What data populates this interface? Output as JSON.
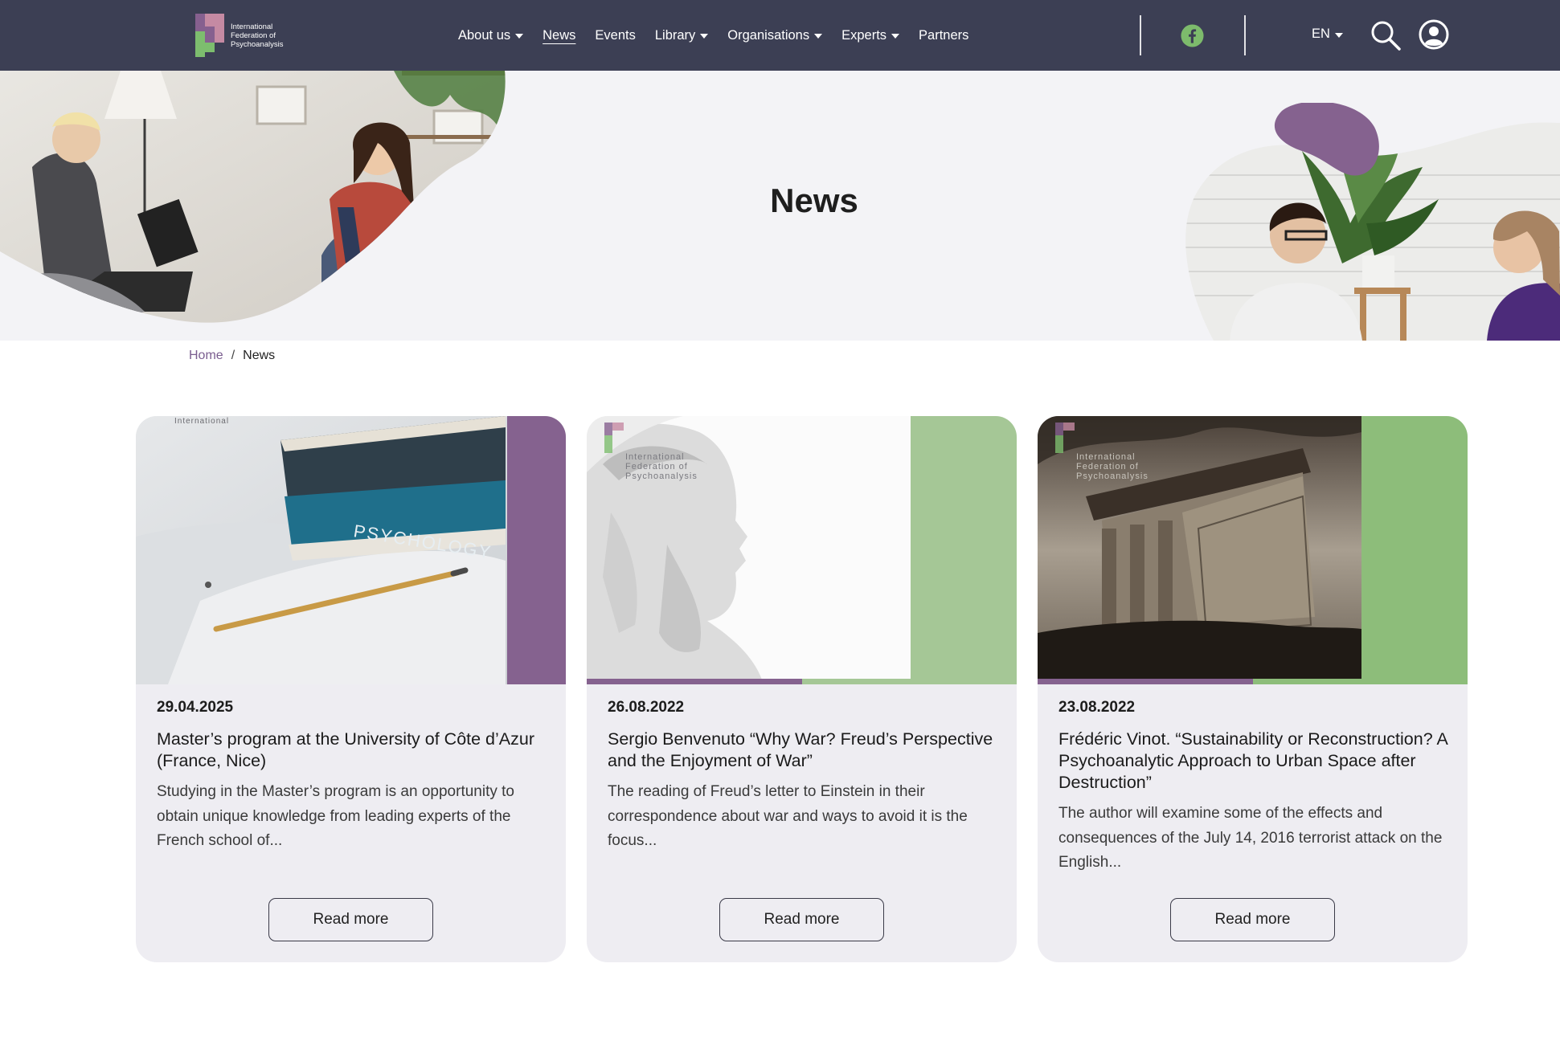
{
  "logo": {
    "lines": [
      "International",
      "Federation of",
      "Psychoanalysis"
    ]
  },
  "nav": {
    "items": [
      {
        "label": "About us",
        "dropdown": true
      },
      {
        "label": "News",
        "dropdown": false,
        "active": true
      },
      {
        "label": "Events",
        "dropdown": false
      },
      {
        "label": "Library",
        "dropdown": true
      },
      {
        "label": "Organisations",
        "dropdown": true
      },
      {
        "label": "Experts",
        "dropdown": true
      },
      {
        "label": "Partners",
        "dropdown": false
      }
    ],
    "language": "EN"
  },
  "icons": {
    "social": "facebook-icon",
    "search": "search-icon",
    "account": "user-circle-icon"
  },
  "hero": {
    "title": "News"
  },
  "breadcrumb": {
    "home": "Home",
    "separator": "/",
    "current": "News"
  },
  "colors": {
    "header_bg": "#3c3f54",
    "accent_purple": "#85628f",
    "accent_green": "#a5c796",
    "accent_green_dark": "#8dbd7a",
    "card_bg": "#eeedf2"
  },
  "cards": [
    {
      "date": "29.04.2025",
      "title": "Master’s program at the University of Côte d’Azur (France, Nice)",
      "excerpt": "Studying in the Master’s program is an opportunity to obtain unique knowledge from leading experts of the French school of...",
      "button": "Read more",
      "image_book_label": "PSYCHOLOGY"
    },
    {
      "date": "26.08.2022",
      "title": "Sergio Benvenuto “Why War? Freud’s Perspective and the Enjoyment of War”",
      "excerpt": "The reading of Freud’s letter to Einstein in their correspondence about war and ways to avoid it is the focus...",
      "button": "Read more"
    },
    {
      "date": "23.08.2022",
      "title": "Frédéric Vinot. “Sustainability or Reconstruction? A Psychoanalytic Approach to Urban Space after Destruction”",
      "excerpt": "The author will examine some of the effects and consequences of the July 14, 2016 terrorist attack on the English...",
      "button": "Read more"
    }
  ]
}
